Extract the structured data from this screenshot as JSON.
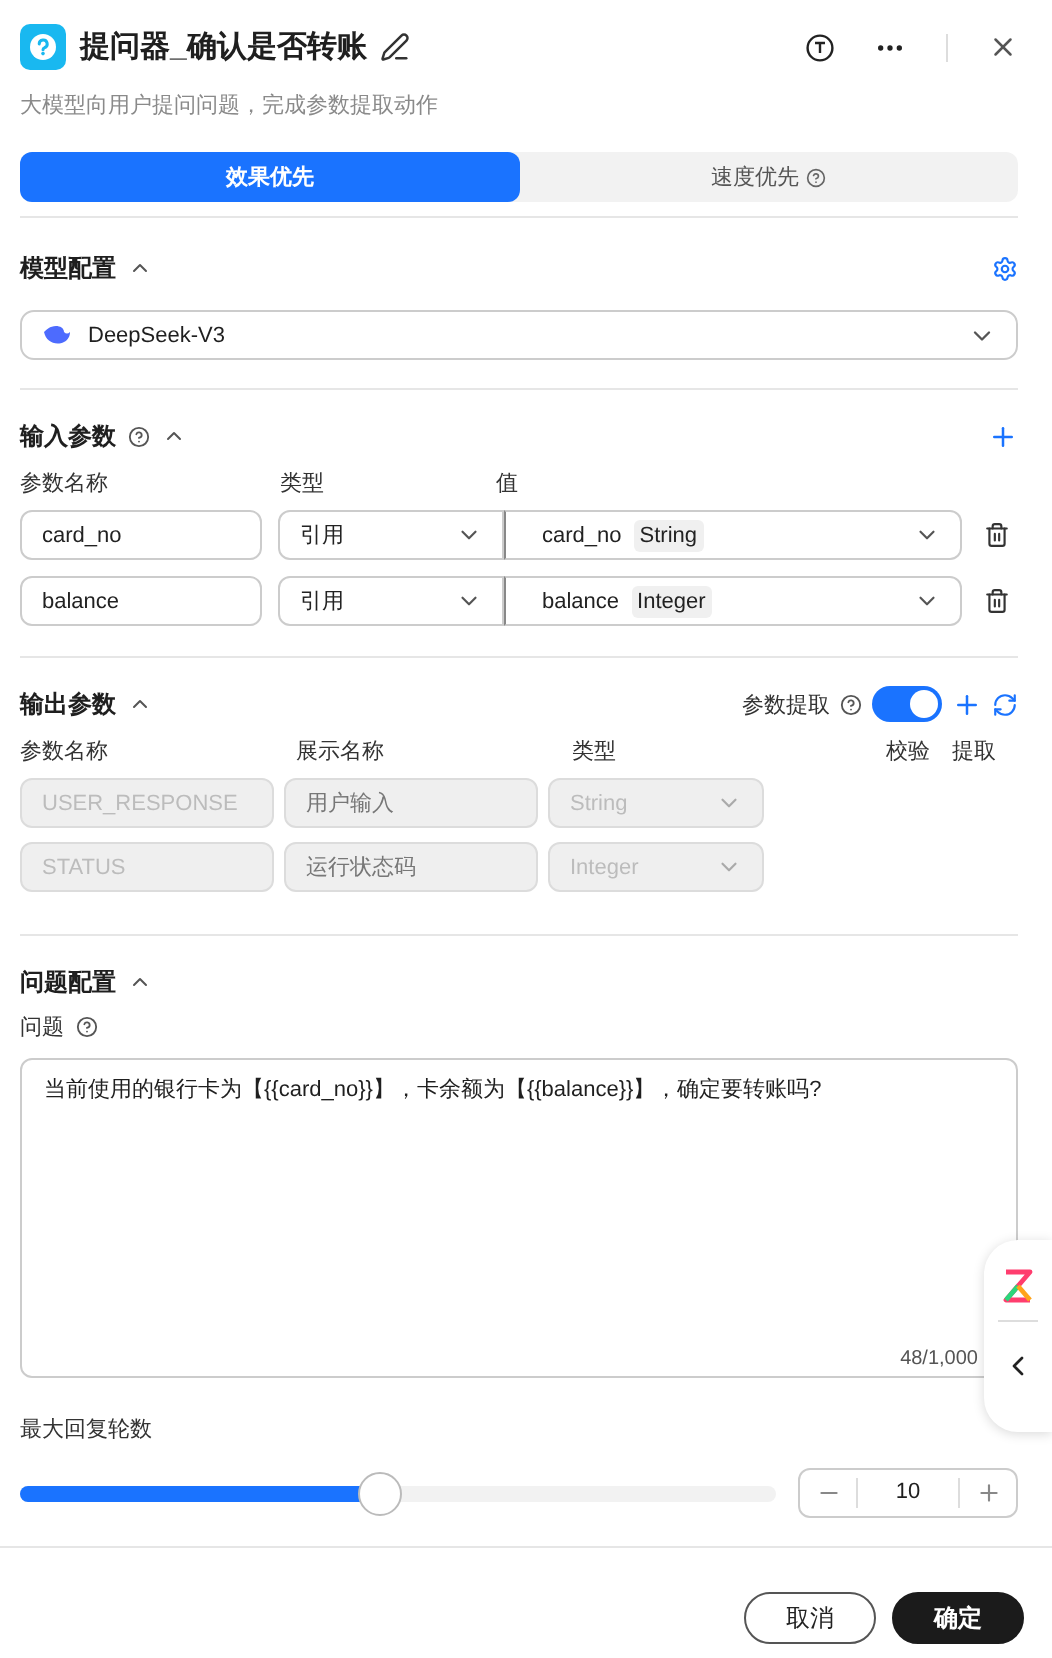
{
  "header": {
    "title": "提问器_确认是否转账",
    "description": "大模型向用户提问问题，完成参数提取动作"
  },
  "tabs": [
    {
      "label": "效果优先",
      "selected": true,
      "help": false
    },
    {
      "label": "速度优先",
      "selected": false,
      "help": true
    }
  ],
  "model_section": {
    "title": "模型配置",
    "expanded": true,
    "model": "DeepSeek-V3"
  },
  "input_section": {
    "title": "输入参数",
    "expanded": true,
    "columns": [
      "参数名称",
      "类型",
      "值"
    ],
    "rows": [
      {
        "name": "card_no",
        "type": "引用",
        "value": "card_no",
        "value_type": "String"
      },
      {
        "name": "balance",
        "type": "引用",
        "value": "balance",
        "value_type": "Integer"
      }
    ]
  },
  "output_section": {
    "title": "输出参数",
    "expanded": true,
    "extract_label": "参数提取",
    "extract_on": true,
    "columns": [
      "参数名称",
      "展示名称",
      "类型",
      "校验",
      "提取"
    ],
    "rows": [
      {
        "name": "USER_RESPONSE",
        "display": "用户输入",
        "type": "String",
        "disabled": true
      },
      {
        "name": "STATUS",
        "display": "运行状态码",
        "type": "Integer",
        "disabled": true
      }
    ]
  },
  "question_section": {
    "title": "问题配置",
    "expanded": true,
    "label": "问题",
    "text": "当前使用的银行卡为【{{card_no}}】，卡余额为【{{balance}}】，确定要转账吗?",
    "counter": "48/1,000"
  },
  "max_rounds": {
    "label": "最大回复轮数",
    "level": 0.476,
    "value": "10"
  },
  "buttons": [
    {
      "label": "取消",
      "kind": "secondary"
    },
    {
      "label": "确定",
      "kind": "primary"
    }
  ]
}
